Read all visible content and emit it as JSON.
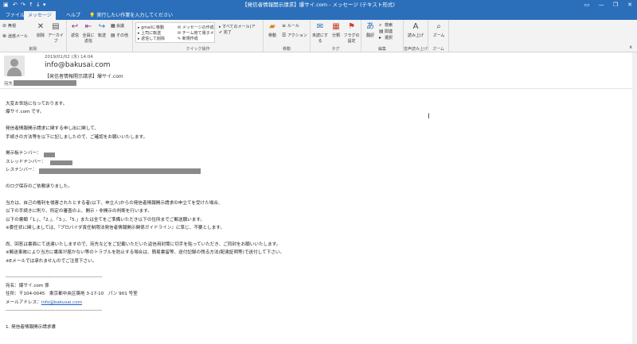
{
  "window": {
    "title": "【発信者情報開示請求】爆サイ.com - メッセージ (テキスト形式)",
    "quick_access": [
      "save-icon",
      "undo-icon",
      "redo-icon",
      "up-icon",
      "down-icon"
    ]
  },
  "tabs": [
    {
      "label": "ファイル"
    },
    {
      "label": "メッセージ",
      "active": true
    },
    {
      "label": "ヘルプ"
    }
  ],
  "tell_me": "実行したい作業を入力してください",
  "ribbon": {
    "delete_group": {
      "label": "削除",
      "ignore": "無視",
      "junk": "迷惑メール",
      "delete": "削除",
      "archive": "アーカイブ"
    },
    "respond_group": {
      "reply": "返信",
      "reply_all": "全員に返信",
      "forward": "転送",
      "meeting": "会議",
      "more": "その他"
    },
    "quick_steps": {
      "label": "クイック操作",
      "items": [
        "gmailに移動",
        "上司に転送",
        "返信して削除",
        "メッセージの作成",
        "チーム宛て電子メ",
        "新規作成",
        "すべてのメール(ア",
        "完了"
      ]
    },
    "move_group": {
      "label": "移動",
      "move": "移動",
      "rules": "ルール",
      "actions": "アクション"
    },
    "tags_group": {
      "label": "タグ",
      "unread": "未読にする",
      "categorize": "分類",
      "followup": "フラグの設定"
    },
    "edit_group": {
      "label": "編集",
      "translate": "翻訳",
      "find": "検索",
      "related": "関連",
      "select": "選択"
    },
    "speech_group": {
      "label": "音声読み上げ",
      "read": "読み上げ"
    },
    "zoom_group": {
      "label": "ズーム",
      "zoom": "ズーム"
    }
  },
  "header": {
    "date": "2019/01/02 (水) 14:04",
    "sender": "info@bakusai.com",
    "subject": "【発信者情報開示請求】爆サイ.com",
    "to_label": "宛先"
  },
  "body": {
    "lines": [
      "大変お世話になっております。",
      "爆サイ.com です。",
      "",
      "発信者情報開示請求に関する申し出に関して、",
      "手続きの方法等を以下に記しましたので、ご確認をお願いいたします。",
      "",
      "掲示板ナンバー：",
      "スレッドナンバー：",
      "レスナンバー：",
      "",
      "のログ保存のご依頼承りました。",
      "",
      "当方は、自己の権利を侵害されたとする者(以下、申立人)からの発信者情報開示請求の申立てを受けた場合、",
      "以下の手続きに則り、所定の審査の上、開示・非開示の判断を行います。",
      "以下の書類「1.」、「2.」、「3.」、「5.」または全てをご準備いただき以下の住所までご郵送願います。",
      "※委任状に関しましては、『プロバイダ責任制限法発信者情報開示関係ガイドライン』に準じ、不要とします。",
      "",
      "尚、回答は書面にて送達いたしますので、宛先などをご記載いただいた返信用封筒に切手を貼っていただき、ご同封をお願いいたします。",
      "※郵送事故により当方に書面が届かない等のトラブルを防止する場合は、簡易書留等、送付記録の残る方法(配達証明等)で送付して下さい。",
      "※Eメールでは承れませんのでご注意下さい。",
      "",
      "------------------------------------------------------------",
      "宛名：爆サイ.com 係",
      "住所：〒104-0045　東京都中央区築地 3-17-10　パン 901 号室",
      "メールアドレス：",
      "------------------------------------------------------------",
      "",
      "1. 発信者情報開示請求書"
    ],
    "email_link": "info@bakusai.com"
  },
  "icons": {
    "reply": "reply-arrow-icon",
    "forward": "forward-arrow-icon"
  }
}
